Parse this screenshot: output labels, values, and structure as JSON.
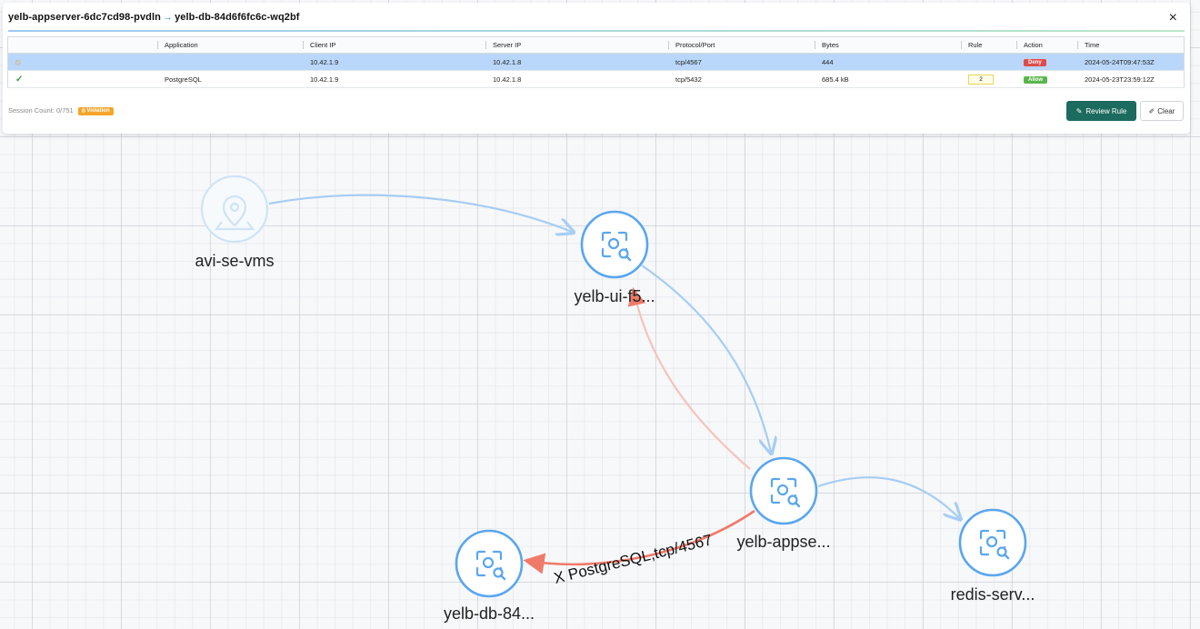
{
  "header": {
    "source": "yelb-appserver-6dc7cd98-pvdln",
    "arrow": "→",
    "destination": "yelb-db-84d6f6fc6c-wq2bf",
    "close_label": "×"
  },
  "table": {
    "columns": [
      "",
      "Application",
      "Client IP",
      "Server IP",
      "Protocol/Port",
      "Bytes",
      "Rule",
      "Action",
      "Time"
    ],
    "rows": [
      {
        "status_icon": "deny-icon",
        "application": "",
        "client_ip": "10.42.1.9",
        "server_ip": "10.42.1.8",
        "protocol_port": "tcp/4567",
        "bytes": "444",
        "rule": "",
        "action": "Deny",
        "time": "2024-05-24T09:47:53Z",
        "selected": true
      },
      {
        "status_icon": "check-icon",
        "application": "PostgreSQL",
        "client_ip": "10.42.1.9",
        "server_ip": "10.42.1.8",
        "protocol_port": "tcp/5432",
        "bytes": "685.4 kB",
        "rule": "2",
        "action": "Allow",
        "time": "2024-05-23T23:59:12Z",
        "selected": false
      }
    ]
  },
  "footer": {
    "session_count": "Session Count: 0/751",
    "violation_label": "Violation",
    "review_rule_label": "Review Rule",
    "clear_label": "Clear"
  },
  "graph": {
    "nodes": [
      {
        "id": "avi",
        "label": "avi-se-vms",
        "icon": "location-pin-icon",
        "faded": true
      },
      {
        "id": "ui",
        "label": "yelb-ui-f5...",
        "icon": "search-icon",
        "faded": false
      },
      {
        "id": "app",
        "label": "yelb-appse...",
        "icon": "search-icon",
        "faded": false
      },
      {
        "id": "db",
        "label": "yelb-db-84...",
        "icon": "search-icon",
        "faded": false
      },
      {
        "id": "redis",
        "label": "redis-serv...",
        "icon": "search-icon",
        "faded": false
      }
    ],
    "edge_label": "X PostgreSQL,tcp/4567",
    "colors": {
      "node_stroke": "#5aa6ee",
      "node_faded": "#cfe3f8",
      "edge_blue": "#a6cdf3",
      "edge_red": "#f07a6a",
      "edge_red_faded": "#f6c3bb"
    }
  }
}
